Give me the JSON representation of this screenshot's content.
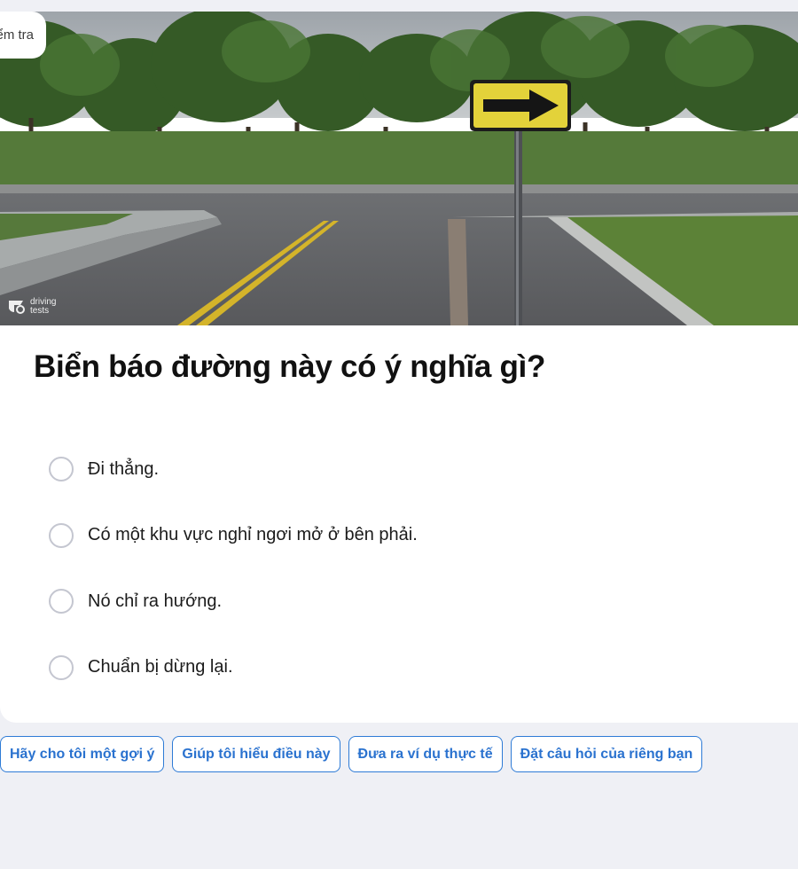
{
  "header": {
    "exam_chip_label": "Kiểm tra"
  },
  "image": {
    "watermark_line1": "driving",
    "watermark_line2": "tests",
    "sign": "yellow-right-arrow-sign"
  },
  "question": {
    "title": "Biển báo đường này có ý nghĩa gì?"
  },
  "options": [
    {
      "label": "Đi thẳng."
    },
    {
      "label": "Có một khu vực nghỉ ngơi mở ở bên phải."
    },
    {
      "label": "Nó chỉ ra hướng."
    },
    {
      "label": "Chuẩn bị dừng lại."
    }
  ],
  "suggestions": [
    {
      "label": "Hãy cho tôi một gợi ý"
    },
    {
      "label": "Giúp tôi hiểu điều này"
    },
    {
      "label": "Đưa ra ví dụ thực tế"
    },
    {
      "label": "Đặt câu hỏi của riêng bạn"
    }
  ],
  "colors": {
    "accent": "#2a72cf",
    "sign_yellow": "#e3d23a",
    "background": "#eff0f5"
  }
}
